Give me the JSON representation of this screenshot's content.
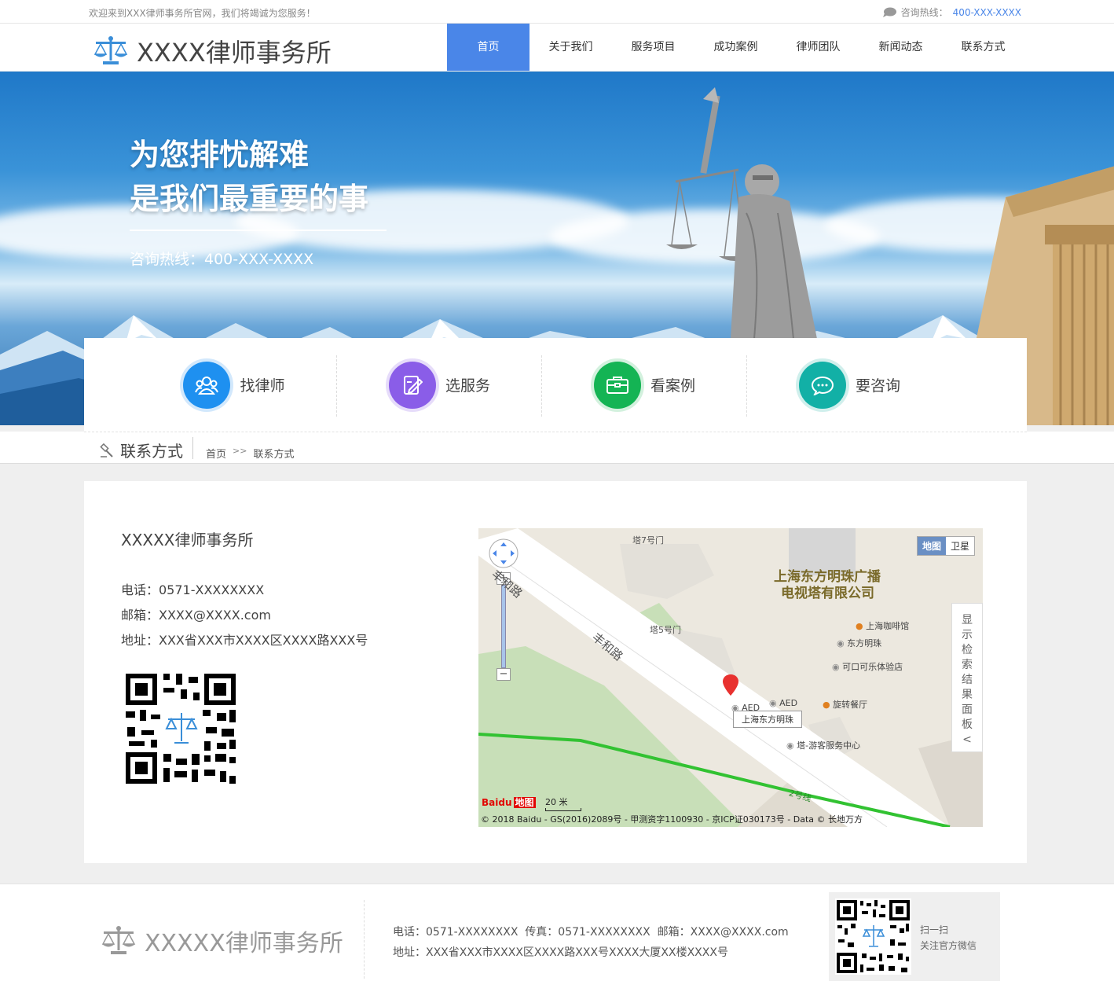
{
  "topbar": {
    "welcome": "欢迎来到XXX律师事务所官网，我们将竭诚为您服务！",
    "hotline_label": "咨询热线：",
    "hotline_number": "400-XXX-XXXX"
  },
  "header": {
    "logo_text": "XXXX律师事务所",
    "nav": [
      "首页",
      "关于我们",
      "服务项目",
      "成功案例",
      "律师团队",
      "新闻动态",
      "联系方式"
    ],
    "active_nav": "首页"
  },
  "banner": {
    "title_line1": "为您排忧解难",
    "title_line2": "是我们最重要的事",
    "hotline": "咨询热线：400-XXX-XXXX"
  },
  "quick_links": [
    {
      "label": "找律师",
      "icon": "team-icon",
      "color": "#1e90f0"
    },
    {
      "label": "选服务",
      "icon": "edit-doc-icon",
      "color": "#8a5de8"
    },
    {
      "label": "看案例",
      "icon": "briefcase-icon",
      "color": "#14b454"
    },
    {
      "label": "要咨询",
      "icon": "chat-icon",
      "color": "#12b0a6"
    }
  ],
  "breadcrumb": {
    "section_title": "联系方式",
    "home": "首页",
    "separator": ">>",
    "current": "联系方式"
  },
  "contact": {
    "company": "XXXXX律师事务所",
    "phone": "电话：0571-XXXXXXXX",
    "email": "邮箱：XXXX@XXXX.com",
    "address": "地址：XXX省XXX市XXXX区XXXX路XXX号"
  },
  "map": {
    "type_map": "地图",
    "type_satellite": "卫星",
    "panel": [
      "显",
      "示",
      "检",
      "索",
      "结",
      "果",
      "面",
      "板",
      "<"
    ],
    "labels": {
      "tower7": "塔7号门",
      "tower5": "塔5号门",
      "company_line1": "上海东方明珠广播",
      "company_line2": "电视塔有限公司",
      "cafe": "上海咖啡馆",
      "pearl": "东方明珠",
      "coke": "可口可乐体验店",
      "aed1": "AED",
      "aed2": "AED",
      "restaurant": "旋转餐厅",
      "marker": "上海东方明珠",
      "visitor": "塔-游客服务中心",
      "road1": "丰和路",
      "road2": "丰和路",
      "line2": "2号线",
      "baidu": "Baidu",
      "baidu_map": "地图"
    },
    "scale": "20 米",
    "copyright": "© 2018 Baidu - GS(2016)2089号 - 甲测资字1100930 - 京ICP证030173号 - Data © 长地万方"
  },
  "footer": {
    "logo_text": "XXXXX律师事务所",
    "line1": "电话：0571-XXXXXXXX  传真：0571-XXXXXXXX  邮箱：XXXX@XXXX.com",
    "line2": "地址：XXX省XXX市XXXX区XXXX路XXX号XXXX大厦XX楼XXXX号",
    "qr_line1": "扫一扫",
    "qr_line2": "关注官方微信"
  },
  "colors": {
    "accent": "#4a86e8",
    "page_bg": "#efefef"
  }
}
